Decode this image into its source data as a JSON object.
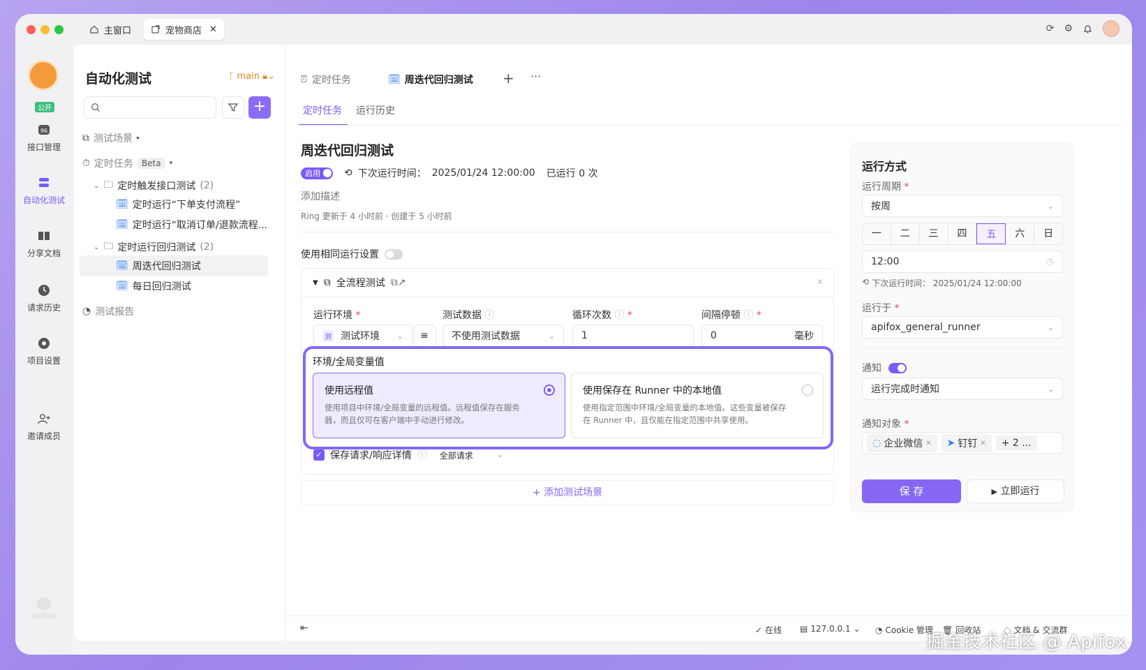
{
  "window_tabs": {
    "home": "主窗口",
    "shop": "宠物商店"
  },
  "rail": {
    "public_label": "公开",
    "items": [
      "接口管理",
      "自动化测试",
      "分享文档",
      "请求历史",
      "项目设置",
      "邀请成员"
    ],
    "brand": "apifox"
  },
  "tree": {
    "title": "自动化测试",
    "branch": "main",
    "scenes": "测试场景",
    "scheduled": "定时任务",
    "beta": "Beta",
    "group1": "定时触发接口测试",
    "group1_count": "(2)",
    "task1": "定时运行“下单支付流程”",
    "task2": "定时运行“取消订单/退款流程...",
    "group2": "定时运行回归测试",
    "group2_count": "(2)",
    "task3": "周迭代回归测试",
    "task4": "每日回归测试",
    "report": "测试报告"
  },
  "main": {
    "doc_tab1": "定时任务",
    "doc_tab2": "周迭代回归测试",
    "subtab1": "定时任务",
    "subtab2": "运行历史",
    "title": "周迭代回归测试",
    "enabled": "启用",
    "next_run_label": "下次运行时间：",
    "next_run": "2025/01/24 12:00:00",
    "run_count": "已运行 0 次",
    "desc_placeholder": "添加描述",
    "meta": "Ring 更新于 4 小时前 · 创建于 5 小时前",
    "same_settings": "使用相同运行设置",
    "scene_name": "全流程测试",
    "env_label": "运行环境",
    "data_label": "测试数据",
    "loop_label": "循环次数",
    "interval_label": "间隔停顿",
    "env_value": "测试环境",
    "env_badge": "测",
    "data_value": "不使用测试数据",
    "loop_value": "1",
    "interval_value": "0",
    "interval_unit": "毫秒",
    "var_title": "环境/全局变量值",
    "opt1_title": "使用远程值",
    "opt1_desc": "使用项目中环境/全局变量的远程值。远程值保存在服务器，而且仅可在客户端中手动进行修改。",
    "opt2_title": "使用保存在 Runner 中的本地值",
    "opt2_desc": "使用指定范围中环境/全局变量的本地值。这些变量被保存在 Runner 中，且仅能在指定范围中共享使用。",
    "save_detail": "保存请求/响应详情",
    "all_requests": "全部请求",
    "add_scene": "+ 添加测试场景"
  },
  "side": {
    "title": "运行方式",
    "period_label": "运行周期",
    "period_value": "按周",
    "days": [
      "一",
      "二",
      "三",
      "四",
      "五",
      "六",
      "日"
    ],
    "selected_day": "五",
    "time": "12:00",
    "next_run": "下次运行时间：  2025/01/24 12:00:00",
    "runner_label": "运行于",
    "runner_value": "apifox_general_runner",
    "notify_label": "通知",
    "notify_value": "运行完成时通知",
    "target_label": "通知对象",
    "chip1": "企业微信",
    "chip2": "钉钉",
    "more": "+ 2 ...",
    "save": "保 存",
    "run_now": "立即运行"
  },
  "status": {
    "online": "在线",
    "host": "127.0.0.1",
    "cookie": "Cookie 管理",
    "recycle": "回收站",
    "docs": "文档 & 交流群"
  },
  "watermark": "掘金技术社区 @ Apifox",
  "colors": {
    "accent": "#7a5af8",
    "branch": "#e08a1b",
    "required": "#e5484d"
  }
}
